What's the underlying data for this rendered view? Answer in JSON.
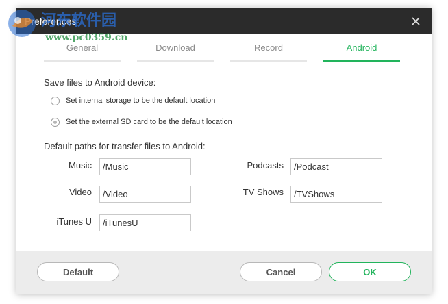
{
  "window": {
    "title": "Preferences"
  },
  "tabs": [
    {
      "label": "General",
      "active": false
    },
    {
      "label": "Download",
      "active": false
    },
    {
      "label": "Record",
      "active": false
    },
    {
      "label": "Android",
      "active": true
    }
  ],
  "android": {
    "save_label": "Save files to Android device:",
    "options": [
      {
        "label": "Set internal storage to be the default location",
        "checked": false
      },
      {
        "label": "Set the external SD card to be the default location",
        "checked": true
      }
    ],
    "paths_label": "Default paths for transfer files to Android:",
    "paths": {
      "music": {
        "label": "Music",
        "value": "/Music"
      },
      "video": {
        "label": "Video",
        "value": "/Video"
      },
      "itunesu": {
        "label": "iTunes U",
        "value": "/iTunesU"
      },
      "podcasts": {
        "label": "Podcasts",
        "value": "/Podcast"
      },
      "tvshows": {
        "label": "TV Shows",
        "value": "/TVShows"
      }
    }
  },
  "footer": {
    "default_label": "Default",
    "cancel_label": "Cancel",
    "ok_label": "OK"
  },
  "watermark": {
    "line1": "河东软件园",
    "line2": "www.pc0359.cn"
  },
  "colors": {
    "accent": "#22b45c",
    "titlebar": "#2b2b2b",
    "footer": "#ececec"
  },
  "icons": {
    "close": "close-icon",
    "watermark_logo": "watermark-logo-icon"
  }
}
